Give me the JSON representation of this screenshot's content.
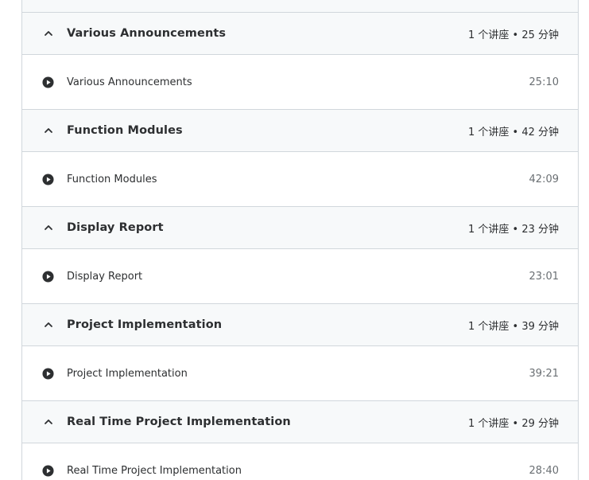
{
  "sections": [
    {
      "title": "Various Announcements",
      "meta": "1 个讲座 • 25 分钟",
      "lecture": {
        "title": "Various Announcements",
        "duration": "25:10"
      }
    },
    {
      "title": "Function Modules",
      "meta": "1 个讲座 • 42 分钟",
      "lecture": {
        "title": "Function Modules",
        "duration": "42:09"
      }
    },
    {
      "title": "Display Report",
      "meta": "1 个讲座 • 23 分钟",
      "lecture": {
        "title": "Display Report",
        "duration": "23:01"
      }
    },
    {
      "title": "Project Implementation",
      "meta": "1 个讲座 • 39 分钟",
      "lecture": {
        "title": "Project Implementation",
        "duration": "39:21"
      }
    },
    {
      "title": "Real Time Project Implementation",
      "meta": "1 个讲座 • 29 分钟",
      "lecture": {
        "title": "Real Time Project Implementation",
        "duration": "28:40"
      }
    }
  ],
  "icons": {
    "section_toggle": "chevron-up-icon",
    "lecture": "play-circle-icon"
  }
}
